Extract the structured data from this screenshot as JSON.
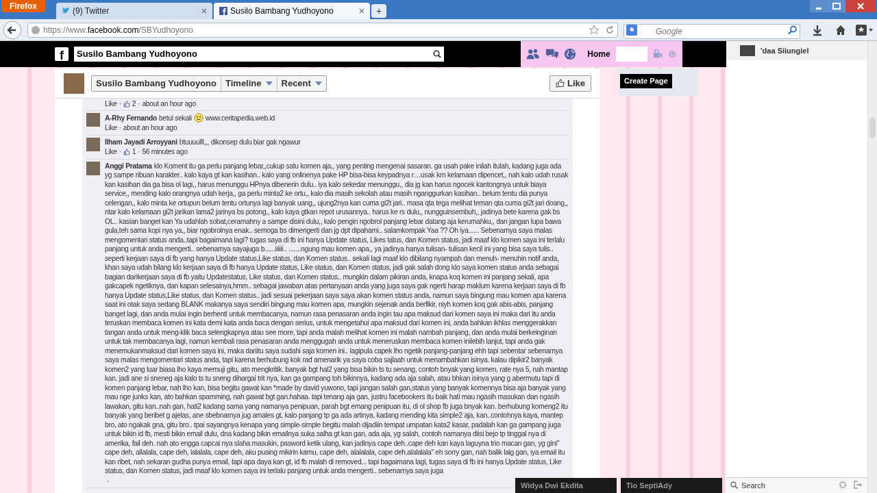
{
  "browser": {
    "menu_button": "Firefox",
    "tabs": [
      {
        "label": "(9) Twitter",
        "selected": false
      },
      {
        "label": "Susilo Bambang Yudhoyono",
        "selected": true
      }
    ],
    "new_tab": "+",
    "url_prefix": "https://www.",
    "url_domain": "facebook.com",
    "url_path": "/SBYudhoyono",
    "search_placeholder": "Google"
  },
  "topbar": {
    "logo": "f",
    "search_value": "Susilo Bambang Yudhoyono",
    "home": "Home"
  },
  "tooltip": "Create Page",
  "page": {
    "name": "Susilo Bambang Yudhoyono",
    "menus": [
      "Timeline",
      "Recent"
    ],
    "like_button": "Like"
  },
  "comments": [
    {
      "like": "Like",
      "likes": "2",
      "time": "about an hour ago"
    },
    {
      "author": "A-Rhy Fernando",
      "text": "betul sekali",
      "emoji": true,
      "link": "www.ceritapedia.web.id",
      "like": "Like",
      "time": "about an hour ago"
    },
    {
      "author": "Ilham Jayadi Arroyyani",
      "text": "btuuuulll,,, dikonsep dulu biar gak ngawur",
      "like": "Like",
      "likes": "1",
      "time": "56 minutes ago"
    },
    {
      "author": "Anggi Pratama",
      "text": "klo Koment itu ga perlu panjang lebar,,cukup satu komen aja,, yang penting mengenai sasaran. ga usah pake inilah itulah, kadang juga ada yg sampe ribuan karakter.. kalo kaya gt kan kasihan.. kalo yang onlinenya pake HP bisa-bisa keypadnya r…usak krn kelamaan dipencet,, nah kalo udah rusak kan kasihan dia ga bisa ol lagi,, harus menunggu HPnya dibenerin dulu.. iya kalo sekedar menunggu,, dia jg kan harus ngocek kantongnya untuk biaya service,, mending kalo orangnya udah kerja,, ga perlu minta2 ke ortu,, kalo dia masih sekolah atau masih nganggurkan kasihan.. belum tentu dia punya celengan,, kalo minta ke ortupun belum tentu ortunya lagi banyak uang,, ujung2nya kan cuma gi2t jari.. masa qta tega melihat teman qta cuma gi2t jari doang,, ntar kalo kelamaan gi2t jarikan lama2 jarinya bs potong,, kalo kaya gtkan repot urusannya.. harus ke rs dulu,, nungguinsembuh,, jadinya bete karena gak bs OL.. kasian banget kan Ya udahlah sobat,ceramahny a sampe disini dulu,, kalo pengin ngobrol panjang lebar datang aja kerumahku,, dan jangan lupa bawa gula,teh sama kopi nya ya,, biar ngobrolnya enak.. semoga bs dimengerti dan jg dpt dipahami.. salamkompak Yaa ?? Oh iya...... Sebenarnya saya malas mengomentari status anda..tapi bagaimana lagi? tugas saya di fb ini hanya Update status, Likes tatus, dan Komen status, jadi maaf klo komen saya ini terlalu panjang untuk anda mengerti.. sebenarnya sayajuga b......iiiiii.. .......ngung mau komen apa,, ya jadinya hanya tulisan- tulisan kecil ini yang bisa saya tulis.. seperti kerjaan saya di fb yang hanya Update status,Like status, dan Komen status.. sekali lagi maaf klo dibilang nyampah dan menuh- menuhin notif anda, khan saya udah bilang klo kerjaan saya di fb hanya Update status, Like status, dan Komen status, jadi gak salah dong klo saya komen status anda sebagai bagian darikerjaan saya di fb yaitu Updatestatus, Like status, dan Komen status.. mungkin dalam pikiran anda, knapa koq komen ini panjang sekali, apa gakcapek ngetiknya, dan kapan selesainya,hmm.. sebagai jawaban atas pertanyaan anda yang juga saya gak ngerti harap maklum karena kerjaan saya di fb hanya Update status,Like status, dan Komen status.. jadi sesuai pekerjaan saya saya akan komen status anda, namun saya bingung mau komen apa karena saat ini otak saya sedang BLANK makanya saya sendiri bingung mau komen apa, mungkin sejenak anda berfikir, niyh komen koq gak abis-abis, panjang banget lagi, dan anda mulai ingin berhenti untuk membacanya, namun rasa penasaran anda ingin tau apa maksud dari komen saya ini maka dari itu anda teruskan membaca komen ini kata demi kata anda baca dengan serius, untuk mengetahui apa maksud dari komen ini, anda bahkan ikhlas menggerakkan tangan anda untuk meng-klik baca selengkapnya atau see more, tapi anda malah melihat komen ini malah nambah panjang, dan anda mulai berkeinginan untuk tak membacanya lagi, namun kembali rasa penasaran anda menggugah anda untuk meneruskan membaca komen inilebih lanjut, tapi anda gak menemukanmaksud dari komen saya ini, maka dariitu saya sudahi saja komen ini.. lagipula capek lho ngetik panjang-panjang ehh tapi sebentar sebenarnya saya malas mengomentari status anda, tapi karena berhubung kok rad amenarik ya saya coba sajlaah untuk menambahkan isinya. kalau dipikir2 banyak komen2 yang luar biasa lho kaya memuji gitu, ato mengkritik. banyak bgt hal2 yang bisa bikin ts tu senang, contoh bnyak yang komen, rate nya 5, nah mantap kan. jadi ane si sneneg aja kalo ts tu sneng dihargai trit nya, kan ga gampang toh bikinnya, kadang ada aja salah, atau bhkan isinya yang g abermutu tapi di komen panjang lebar, nah lho kan, bisa begitu gawat kan *made by david yuwono, tapi jangan salah gan,status yang banyak komennya bisa aja banyak yang mau nge junks kan, ato bahkan spamming, nah gawat bgt gan.hahaa. tapi tenang aja gan, justru facebookers itu baik hati mau ngasih masukan dan ngasih lawakan, gitu kan..nah gan, hati2 kadang sama yang namanya penipuan, parah bgt emang penipuan itu, di ol shop fb juga bnyak kan. berhubung komeng2 itu banyak yang beribet g ajelas, ane sbebnarnya jug amales gt, kalo panjang tp ga ada artinya, kadang mending kita simple2 aja, kan..contohnya kaya, mantep bro, ato ngakak gna, gitu bro.. tpai sayangnya kenapa yang simple-simple begitu malah dijadiin tempat umpatan kata2 kasar, padalah kan ga gampang juga untuk bikin id fb, mesti bikin email dulu, dna kadang bikin emailnya suka salha gt kan gan, ada aja, yg salah, contoh namanya diisi bejo tp tinggal nya di amerika, fail deh. nah ato engga capcai nya slaha masukin, pasword ketik ulang, kan jadinya cape deh..cape deh kan kaya laguyna trio macan gan, yg gini\" cape deh, allalala, cape deh, lalalala, cape deh, aku pusing mikirin kamu, cape deh, alalalala, cape deh.alalalala\" eh sorry gan, nah balik laig gan, iya email itu kan ribet, nah sekaran gudha punya email, tapi apa daya kan gt, id fb malah di removed... tapi bagaimana lagi, tugas saya di fb ini hanya Update status, Like status, dan Komen status, jadi maaf klo komen saya ini terlalu panjang untuk anda mengerti.. sebenarnya saya juga"
    }
  ],
  "separator": "·",
  "chat": {
    "top_contact": "'daa Siiungiel",
    "search_placeholder": "Search",
    "tabs": [
      "Widya Dwi Ekdita",
      "Tio SeptiAdy"
    ]
  }
}
